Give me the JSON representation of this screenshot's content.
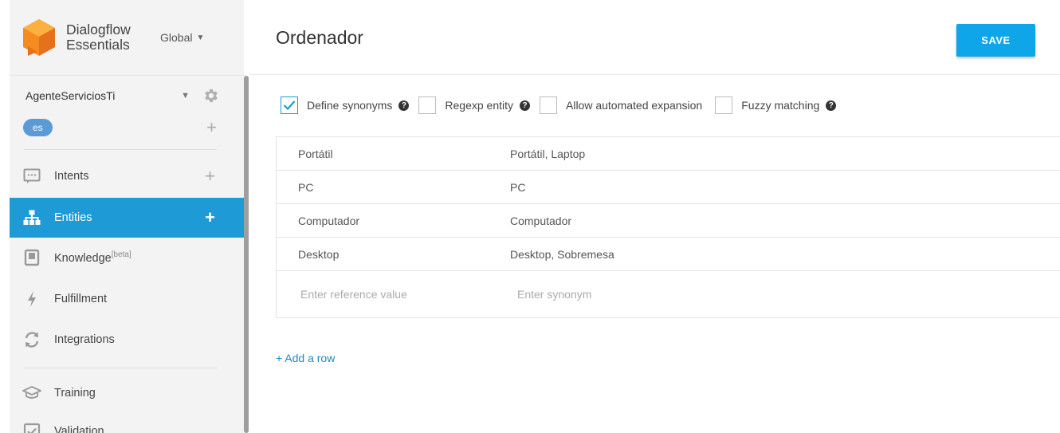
{
  "brand": {
    "line1": "Dialogflow",
    "line2": "Essentials",
    "region": "Global"
  },
  "agent": {
    "name": "AgenteServiciosTi",
    "language": "es"
  },
  "nav": {
    "intents": "Intents",
    "entities": "Entities",
    "knowledge": "Knowledge",
    "knowledge_badge": "[beta]",
    "fulfillment": "Fulfillment",
    "integrations": "Integrations",
    "training": "Training",
    "validation": "Validation"
  },
  "header": {
    "title": "Ordenador",
    "save_label": "SAVE"
  },
  "options": {
    "define_synonyms": {
      "label": "Define synonyms",
      "checked": true
    },
    "regexp_entity": {
      "label": "Regexp entity",
      "checked": false
    },
    "automated_expansion": {
      "label": "Allow automated expansion",
      "checked": false
    },
    "fuzzy_matching": {
      "label": "Fuzzy matching",
      "checked": false
    }
  },
  "entries": [
    {
      "reference": "Portátil",
      "synonyms": "Portátil, Laptop"
    },
    {
      "reference": "PC",
      "synonyms": "PC"
    },
    {
      "reference": "Computador",
      "synonyms": "Computador"
    },
    {
      "reference": "Desktop",
      "synonyms": "Desktop, Sobremesa"
    }
  ],
  "new_entry": {
    "reference_placeholder": "Enter reference value",
    "synonym_placeholder": "Enter synonym"
  },
  "add_row_label": "+ Add a row",
  "icons": [
    "dialogflow-logo-icon",
    "caret-down-icon",
    "gear-icon",
    "plus-icon",
    "chat-icon",
    "sitemap-icon",
    "book-icon",
    "bolt-icon",
    "sync-icon",
    "graduation-cap-icon",
    "check-square-icon",
    "help-icon",
    "checkmark-icon"
  ],
  "colors": {
    "accent": "#1e9ad6",
    "save_button": "#0ea5e9",
    "language_badge": "#5b9bd5",
    "logo_orange": "#f68b1f"
  }
}
